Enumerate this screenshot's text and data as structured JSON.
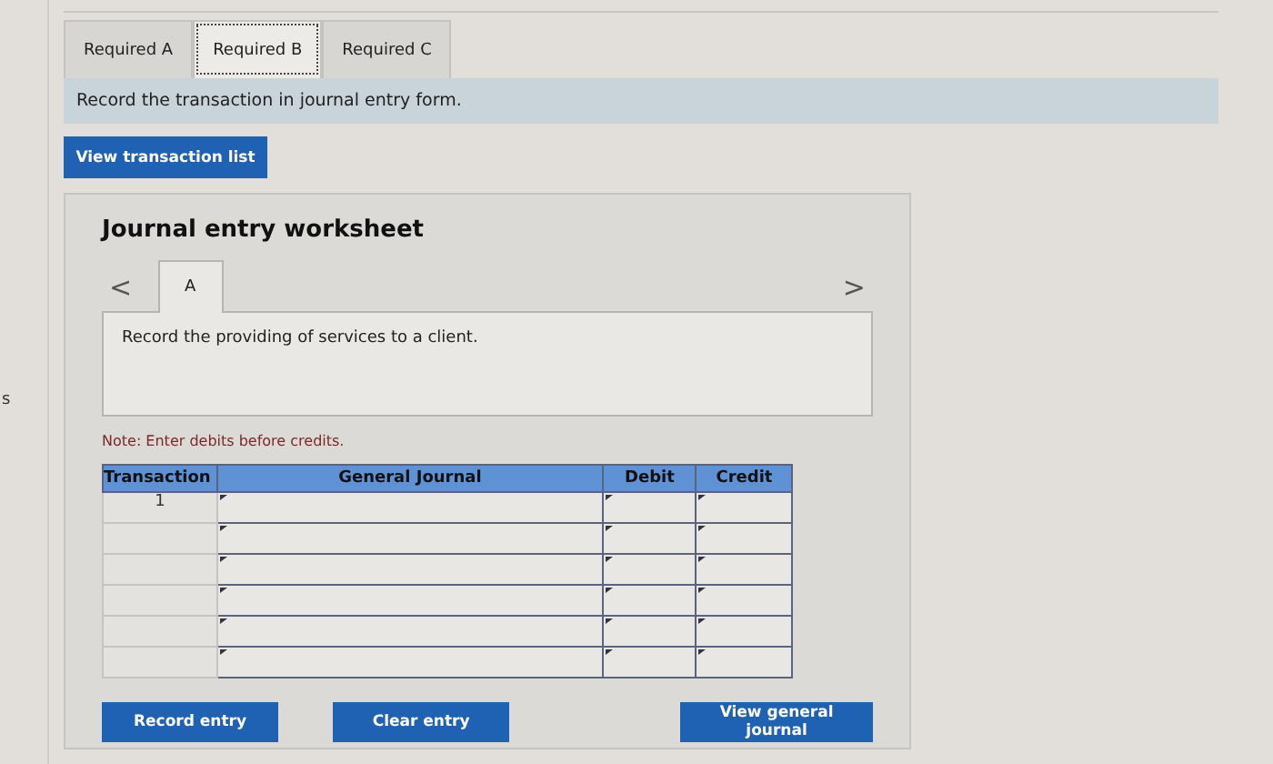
{
  "edge_text": "s",
  "tabs": [
    {
      "label": "Required A",
      "selected": false
    },
    {
      "label": "Required B",
      "selected": true
    },
    {
      "label": "Required C",
      "selected": false
    }
  ],
  "instruction": "Record the transaction in journal entry form.",
  "view_transaction_button": "View transaction list",
  "worksheet": {
    "title": "Journal entry worksheet",
    "prev": "<",
    "next": ">",
    "entry_tabs": [
      {
        "label": "A",
        "selected": true
      }
    ],
    "description": "Record the providing of services to a client.",
    "note": "Note: Enter debits before credits.",
    "columns": [
      "Transaction",
      "General Journal",
      "Debit",
      "Credit"
    ],
    "rows": [
      {
        "transaction": "1"
      },
      {},
      {},
      {},
      {},
      {}
    ],
    "buttons": [
      "Record entry",
      "Clear entry",
      "View general journal"
    ]
  }
}
